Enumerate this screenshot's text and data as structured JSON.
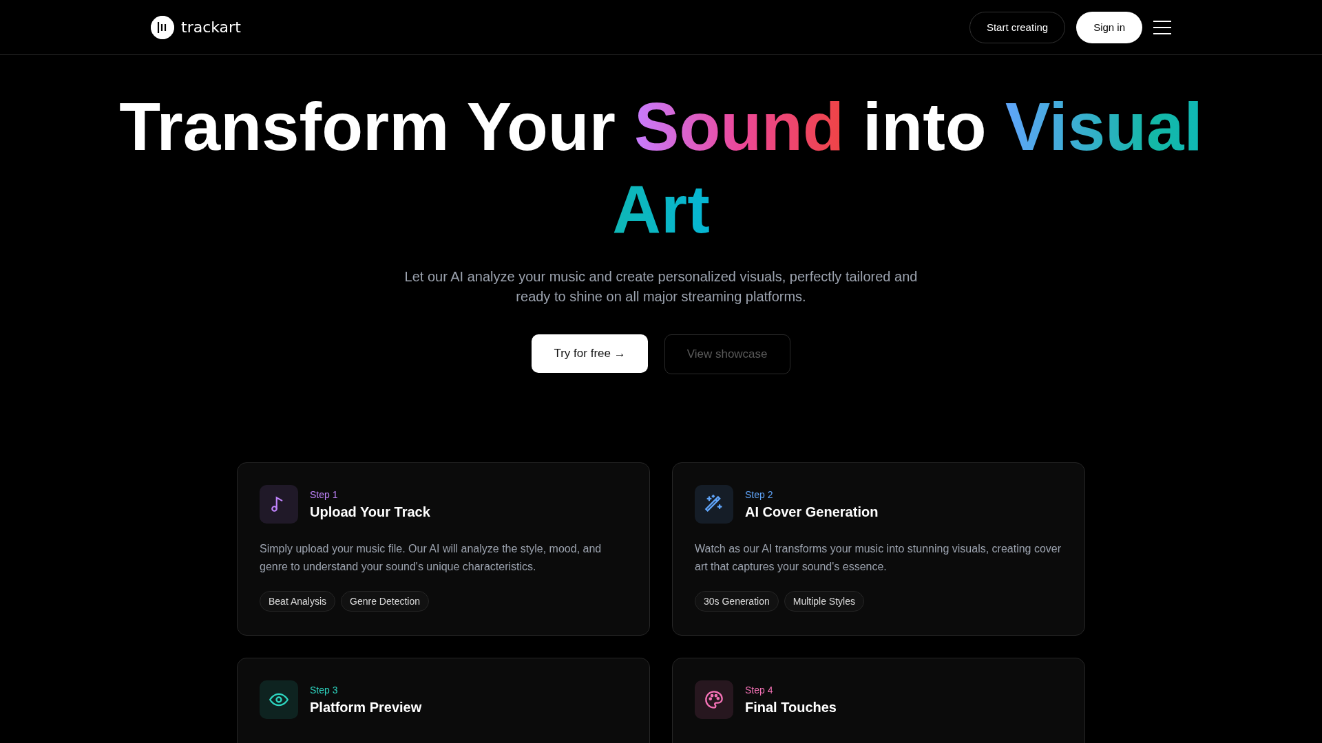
{
  "header": {
    "brand": "trackart",
    "buttons": [
      {
        "label": "Start creating",
        "kind": "outline"
      },
      {
        "label": "Sign in",
        "kind": "solid"
      }
    ]
  },
  "hero": {
    "title": [
      {
        "text": "Transform Your ",
        "kind": "plain"
      },
      {
        "text": "Sound",
        "kind": "warm"
      },
      {
        "text": " into ",
        "kind": "plain"
      },
      {
        "text": "Visual Art",
        "kind": "cool"
      }
    ],
    "subtitle": "Let our AI analyze your music and create personalized visuals, perfectly tailored and ready to shine on all major streaming platforms.",
    "buttons": [
      {
        "label": "Try for free →",
        "kind": "solid"
      },
      {
        "label": "View showcase",
        "kind": "ghost"
      }
    ]
  },
  "steps": [
    {
      "step": "Step 1",
      "title": "Upload Your Track",
      "color": "#c084fc",
      "description": "Simply upload your music file. Our AI will analyze the style, mood, and genre to understand your sound's unique characteristics.",
      "tags": [
        "Beat Analysis",
        "Genre Detection"
      ]
    },
    {
      "step": "Step 2",
      "title": "AI Cover Generation",
      "color": "#60a5fa",
      "description": "Watch as our AI transforms your music into stunning visuals, creating cover art that captures your sound's essence.",
      "tags": [
        "30s Generation",
        "Multiple Styles"
      ]
    },
    {
      "step": "Step 3",
      "title": "Platform Preview",
      "color": "#2dd4bf"
    },
    {
      "step": "Step 4",
      "title": "Final Touches",
      "color": "#f472b6"
    }
  ]
}
